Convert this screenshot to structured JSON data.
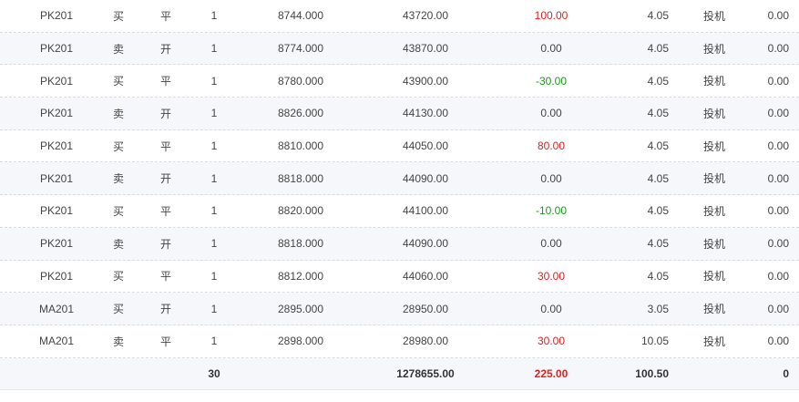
{
  "colors": {
    "positive": "#e02020",
    "negative": "#1a9b1a"
  },
  "rows": [
    {
      "contract": "PK201",
      "direction": "买",
      "offset": "平",
      "qty": "1",
      "price": "8744.000",
      "amount": "43720.00",
      "pnl": "100.00",
      "pnl_sign": "pos",
      "fee": "4.05",
      "type": "投机",
      "last": "0.00"
    },
    {
      "contract": "PK201",
      "direction": "卖",
      "offset": "开",
      "qty": "1",
      "price": "8774.000",
      "amount": "43870.00",
      "pnl": "0.00",
      "pnl_sign": "zero",
      "fee": "4.05",
      "type": "投机",
      "last": "0.00"
    },
    {
      "contract": "PK201",
      "direction": "买",
      "offset": "平",
      "qty": "1",
      "price": "8780.000",
      "amount": "43900.00",
      "pnl": "-30.00",
      "pnl_sign": "neg",
      "fee": "4.05",
      "type": "投机",
      "last": "0.00"
    },
    {
      "contract": "PK201",
      "direction": "卖",
      "offset": "开",
      "qty": "1",
      "price": "8826.000",
      "amount": "44130.00",
      "pnl": "0.00",
      "pnl_sign": "zero",
      "fee": "4.05",
      "type": "投机",
      "last": "0.00"
    },
    {
      "contract": "PK201",
      "direction": "买",
      "offset": "平",
      "qty": "1",
      "price": "8810.000",
      "amount": "44050.00",
      "pnl": "80.00",
      "pnl_sign": "pos",
      "fee": "4.05",
      "type": "投机",
      "last": "0.00"
    },
    {
      "contract": "PK201",
      "direction": "卖",
      "offset": "开",
      "qty": "1",
      "price": "8818.000",
      "amount": "44090.00",
      "pnl": "0.00",
      "pnl_sign": "zero",
      "fee": "4.05",
      "type": "投机",
      "last": "0.00"
    },
    {
      "contract": "PK201",
      "direction": "买",
      "offset": "平",
      "qty": "1",
      "price": "8820.000",
      "amount": "44100.00",
      "pnl": "-10.00",
      "pnl_sign": "neg",
      "fee": "4.05",
      "type": "投机",
      "last": "0.00"
    },
    {
      "contract": "PK201",
      "direction": "卖",
      "offset": "开",
      "qty": "1",
      "price": "8818.000",
      "amount": "44090.00",
      "pnl": "0.00",
      "pnl_sign": "zero",
      "fee": "4.05",
      "type": "投机",
      "last": "0.00"
    },
    {
      "contract": "PK201",
      "direction": "买",
      "offset": "平",
      "qty": "1",
      "price": "8812.000",
      "amount": "44060.00",
      "pnl": "30.00",
      "pnl_sign": "pos",
      "fee": "4.05",
      "type": "投机",
      "last": "0.00"
    },
    {
      "contract": "MA201",
      "direction": "买",
      "offset": "开",
      "qty": "1",
      "price": "2895.000",
      "amount": "28950.00",
      "pnl": "0.00",
      "pnl_sign": "zero",
      "fee": "3.05",
      "type": "投机",
      "last": "0.00"
    },
    {
      "contract": "MA201",
      "direction": "卖",
      "offset": "平",
      "qty": "1",
      "price": "2898.000",
      "amount": "28980.00",
      "pnl": "30.00",
      "pnl_sign": "pos",
      "fee": "10.05",
      "type": "投机",
      "last": "0.00"
    }
  ],
  "totals": {
    "qty": "30",
    "amount": "1278655.00",
    "pnl": "225.00",
    "fee": "100.50",
    "last": "0"
  }
}
